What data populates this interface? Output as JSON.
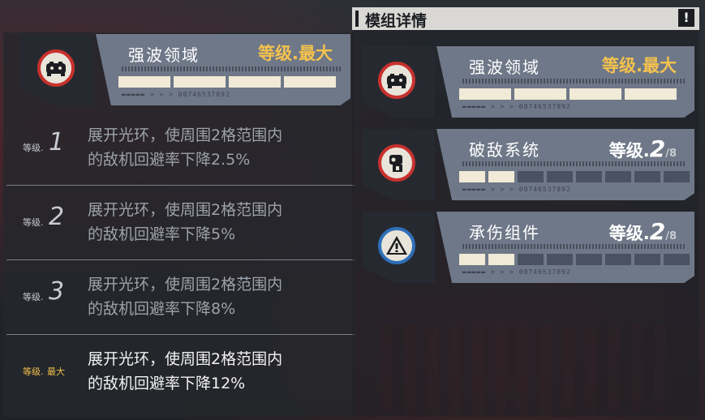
{
  "header": {
    "title": "模组详情",
    "info_glyph": "!"
  },
  "selected_module": {
    "name": "强波领域",
    "level_label": "等级.最大",
    "icon": "controller-icon",
    "fine_print": "BL DURAS PAISS FOS ASSUARSITY OF FFF GGCSGRAE BARJNTRS FORKEREA",
    "serial": "▬▬▬▬▬ > > > 00746537892",
    "segments_filled": 4,
    "segments_total": 4
  },
  "levels": [
    {
      "label": "等级.",
      "num": "1",
      "desc": "展开光环，使周围2格范围内\n的敌机回避率下降2.5%"
    },
    {
      "label": "等级.",
      "num": "2",
      "desc": "展开光环，使周围2格范围内\n的敌机回避率下降5%"
    },
    {
      "label": "等级.",
      "num": "3",
      "desc": "展开光环，使周围2格范围内\n的敌机回避率下降8%"
    },
    {
      "label": "等级.",
      "num": "最大",
      "desc": "展开光环，使周围2格范围内\n的敌机回避率下降12%"
    }
  ],
  "modules": [
    {
      "name": "强波领域",
      "level_label": "等级.最大",
      "level_num": "",
      "level_max": "",
      "icon": "controller-icon",
      "serial": "▬▬▬▬▬ > > > 00746537892",
      "segments_filled": 4,
      "segments_total": 4
    },
    {
      "name": "破敌系统",
      "level_label": "等级.",
      "level_num": "2",
      "level_max": "/8",
      "icon": "robot-head-icon",
      "serial": "▬▬▬▬▬ > > > 00746537892",
      "segments_filled": 2,
      "segments_total": 8
    },
    {
      "name": "承伤组件",
      "level_label": "等级.",
      "level_num": "2",
      "level_max": "/8",
      "icon": "warning-icon",
      "serial": "▬▬▬▬▬ > > > 00746537892",
      "segments_filled": 2,
      "segments_total": 8
    }
  ],
  "colors": {
    "accent_gold": "#f4c24d",
    "card_steel": "#6f7888",
    "segment_filled": "#f0ead6",
    "segment_empty": "#4a5160",
    "icon_ring_red": "#c8312e",
    "icon_ring_blue": "#2f6fb8"
  }
}
